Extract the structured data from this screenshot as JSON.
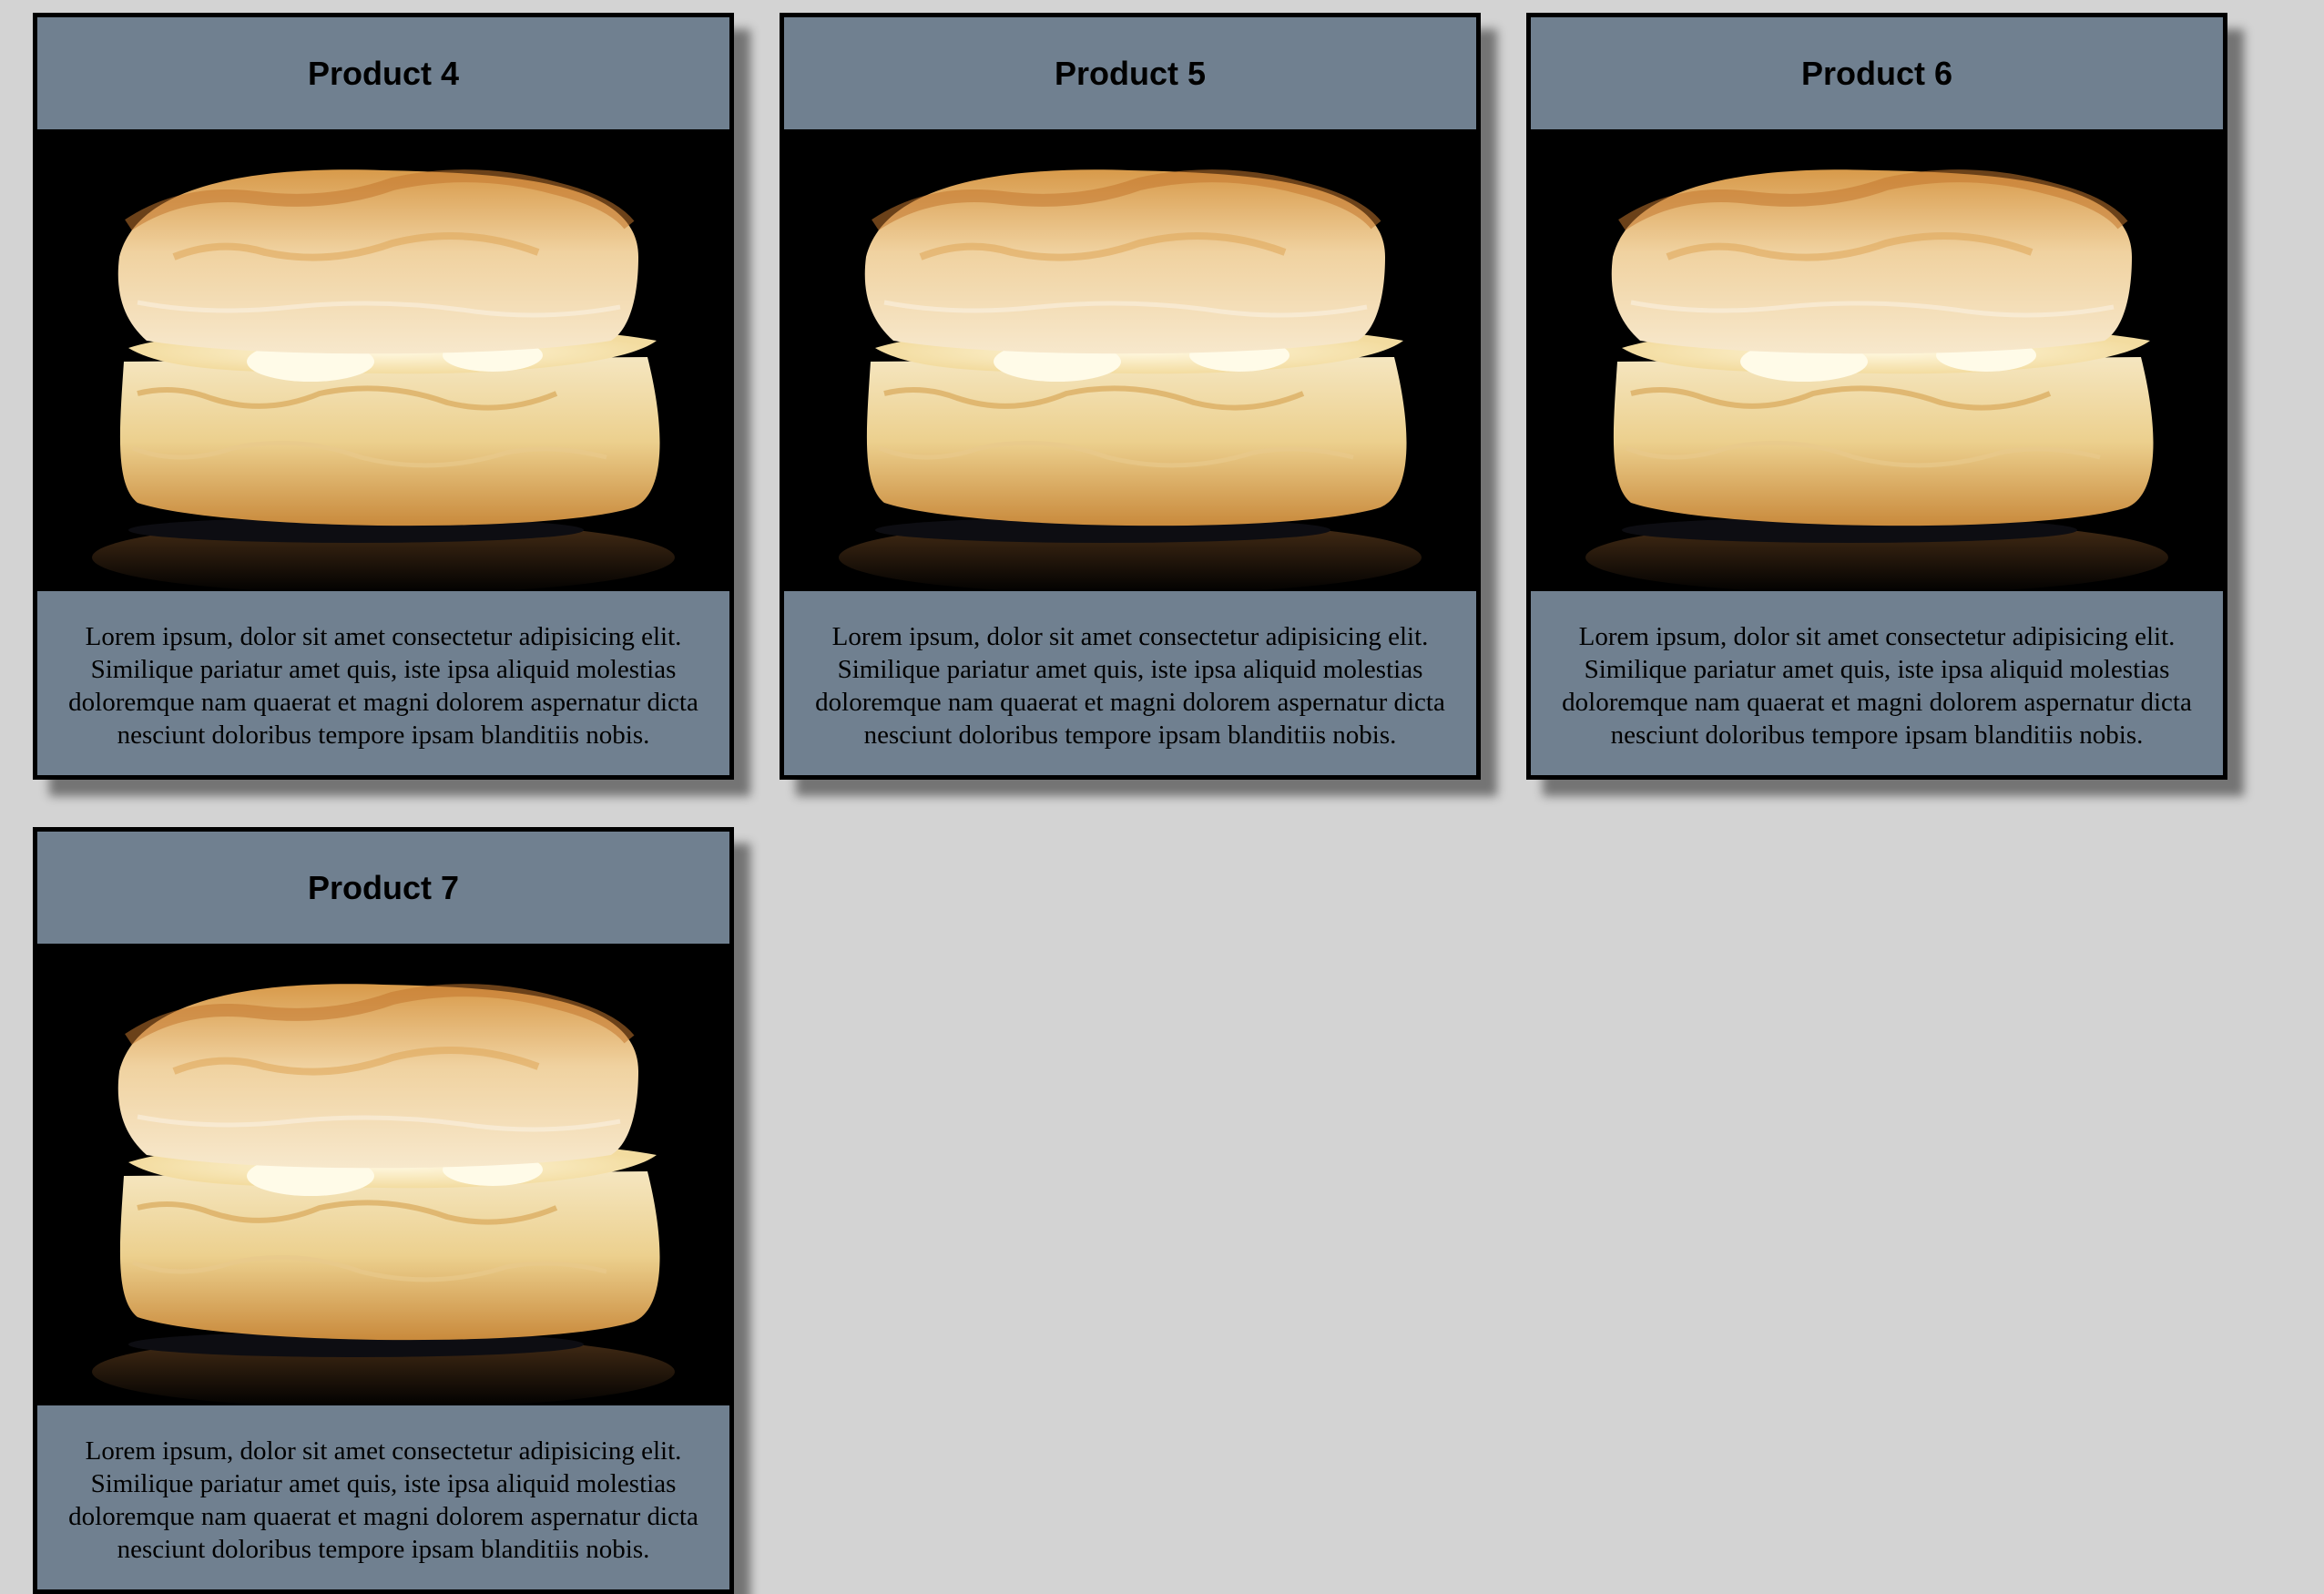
{
  "products": [
    {
      "title": "Product 4",
      "image": "biscuit-photo",
      "description": "Lorem ipsum, dolor sit amet consectetur adipisicing elit. Similique pariatur amet quis, iste ipsa aliquid molestias doloremque nam quaerat et magni dolorem aspernatur dicta nesciunt doloribus tempore ipsam blanditiis nobis."
    },
    {
      "title": "Product 5",
      "image": "biscuit-photo",
      "description": "Lorem ipsum, dolor sit amet consectetur adipisicing elit. Similique pariatur amet quis, iste ipsa aliquid molestias doloremque nam quaerat et magni dolorem aspernatur dicta nesciunt doloribus tempore ipsam blanditiis nobis."
    },
    {
      "title": "Product 6",
      "image": "biscuit-photo",
      "description": "Lorem ipsum, dolor sit amet consectetur adipisicing elit. Similique pariatur amet quis, iste ipsa aliquid molestias doloremque nam quaerat et magni dolorem aspernatur dicta nesciunt doloribus tempore ipsam blanditiis nobis."
    },
    {
      "title": "Product 7",
      "image": "biscuit-photo",
      "description": "Lorem ipsum, dolor sit amet consectetur adipisicing elit. Similique pariatur amet quis, iste ipsa aliquid molestias doloremque nam quaerat et magni dolorem aspernatur dicta nesciunt doloribus tempore ipsam blanditiis nobis."
    }
  ],
  "colors": {
    "page_background": "#d3d3d3",
    "card_background": "#708090",
    "card_border": "#000000"
  }
}
